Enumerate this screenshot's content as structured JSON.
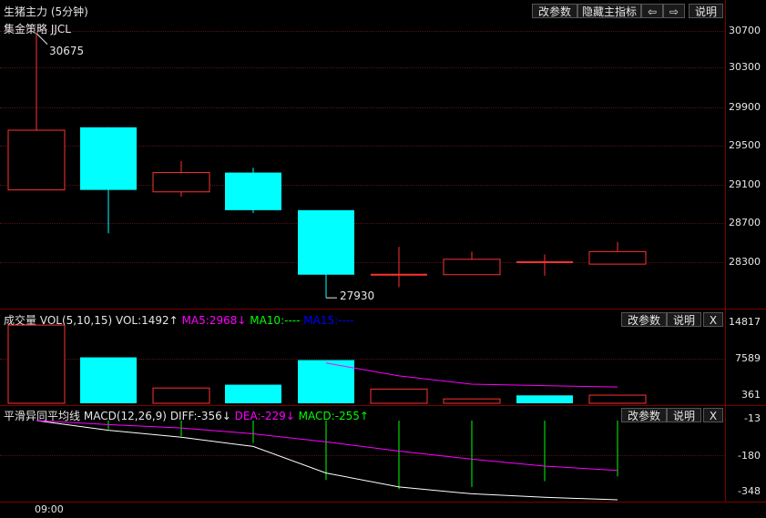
{
  "header": {
    "title": "生猪主力 (5分钟)",
    "buttons": {
      "params": "改参数",
      "hide_indicator": "隐藏主指标",
      "explain": "说明"
    }
  },
  "main_panel": {
    "indicator_label": "集金策略 JJCL",
    "y_ticks": [
      "30700",
      "30300",
      "29900",
      "29500",
      "29100",
      "28700",
      "28300"
    ],
    "high_annotation": "30675",
    "low_annotation": "27930"
  },
  "volume_panel": {
    "label_name": "成交量",
    "label_params": "VOL(5,10,15)",
    "vol": "VOL:1492↑",
    "ma5": "MA5:2968↓",
    "ma10": "MA10:----",
    "ma15": "MA15:----",
    "y_ticks": [
      "14817",
      "7589",
      "361"
    ],
    "buttons": {
      "params": "改参数",
      "explain": "说明",
      "close": "X"
    }
  },
  "macd_panel": {
    "label_name": "平滑异同平均线",
    "label_params": "MACD(12,26,9)",
    "diff": "DIFF:-356↓",
    "dea": "DEA:-229↓",
    "macd": "MACD:-255↑",
    "y_ticks": [
      "-13",
      "-180",
      "-348"
    ],
    "buttons": {
      "params": "改参数",
      "explain": "说明",
      "close": "X"
    }
  },
  "time_axis": {
    "start_label": "09:00"
  },
  "colors": {
    "up": "#ff3232",
    "down": "#00ffff",
    "ma5": "#ff00ff",
    "ma10": "#00ff00",
    "ma15": "#0000ff",
    "diff": "#ffffff",
    "dea": "#ff00ff",
    "macd_bar": "#00ff00",
    "separator": "#7a0000"
  },
  "chart_data": [
    {
      "type": "candlestick",
      "title": "生猪主力 (5分钟)",
      "yticks": [
        30700,
        30300,
        29900,
        29500,
        29100,
        28700,
        28300
      ],
      "ylim": [
        27930,
        30675
      ],
      "candles": [
        {
          "open": 29050,
          "close": 29670,
          "high": 30675,
          "low": 29050
        },
        {
          "open": 29700,
          "close": 29050,
          "high": 29700,
          "low": 28600
        },
        {
          "open": 29030,
          "close": 29230,
          "high": 29350,
          "low": 28980
        },
        {
          "open": 29230,
          "close": 28840,
          "high": 29280,
          "low": 28810
        },
        {
          "open": 28840,
          "close": 28170,
          "high": 28840,
          "low": 27930
        },
        {
          "open": 28170,
          "close": 28170,
          "high": 28460,
          "low": 28040
        },
        {
          "open": 28170,
          "close": 28330,
          "high": 28410,
          "low": 28170
        },
        {
          "open": 28300,
          "close": 28300,
          "high": 28380,
          "low": 28160
        },
        {
          "open": 28280,
          "close": 28410,
          "high": 28510,
          "low": 28280
        }
      ]
    },
    {
      "type": "bar",
      "title": "VOL(5,10,15)",
      "yticks": [
        14817,
        7589,
        361
      ],
      "values": [
        14300,
        8400,
        2800,
        3400,
        7900,
        2600,
        800,
        1450,
        1492
      ],
      "up": [
        true,
        false,
        true,
        false,
        false,
        true,
        true,
        false,
        true
      ],
      "series": [
        {
          "name": "MA5",
          "values": [
            null,
            null,
            null,
            null,
            7360,
            5020,
            3500,
            3230,
            2968
          ]
        }
      ]
    },
    {
      "type": "line",
      "title": "MACD(12,26,9)",
      "yticks": [
        -13,
        -180,
        -348
      ],
      "series": [
        {
          "name": "DIFF",
          "values": [
            -13,
            -55,
            -85,
            -125,
            -240,
            -300,
            -330,
            -345,
            -356
          ]
        },
        {
          "name": "DEA",
          "values": [
            -13,
            -30,
            -45,
            -70,
            -105,
            -145,
            -180,
            -210,
            -229
          ]
        }
      ],
      "macd_values": [
        -13,
        -50,
        -80,
        -110,
        -270,
        -310,
        -300,
        -275,
        -255
      ]
    }
  ]
}
